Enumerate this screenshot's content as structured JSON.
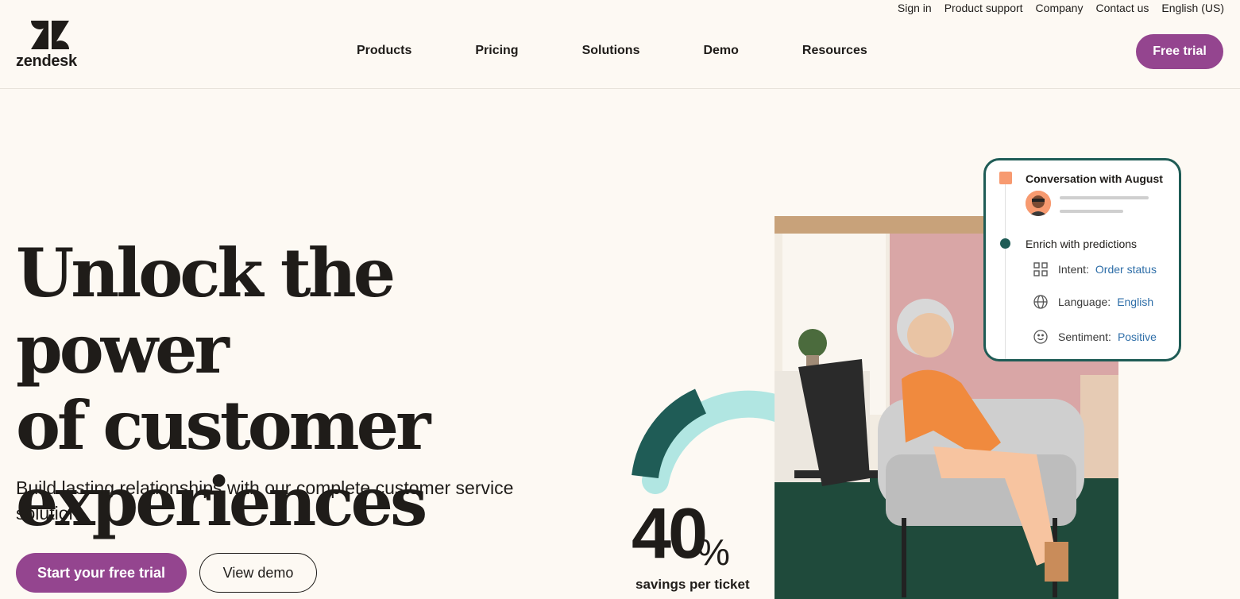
{
  "utility_nav": [
    "Sign in",
    "Product support",
    "Company",
    "Contact us",
    "English (US)"
  ],
  "brand": {
    "name": "zendesk"
  },
  "main_nav": [
    "Products",
    "Pricing",
    "Solutions",
    "Demo",
    "Resources"
  ],
  "header_cta": "Free trial",
  "hero": {
    "headline_lines": [
      "Unlock the power",
      "of customer",
      "experiences"
    ],
    "subheadline": "Build lasting relationships with our complete customer service solution.",
    "primary_cta": "Start your free trial",
    "secondary_cta": "View demo"
  },
  "stat": {
    "value": "40",
    "unit": "%",
    "label": "savings per ticket"
  },
  "card": {
    "title": "Conversation with August",
    "section": "Enrich with predictions",
    "rows": [
      {
        "icon": "grid-icon",
        "label": "Intent:",
        "value": "Order status"
      },
      {
        "icon": "globe-icon",
        "label": "Language:",
        "value": "English"
      },
      {
        "icon": "smiley-icon",
        "label": "Sentiment:",
        "value": "Positive"
      }
    ]
  },
  "colors": {
    "brand_purple": "#94458f",
    "dark_teal": "#1f5c56",
    "mint": "#b1e6e2",
    "accent_orange": "#f79a70",
    "background": "#fdf9f3"
  }
}
